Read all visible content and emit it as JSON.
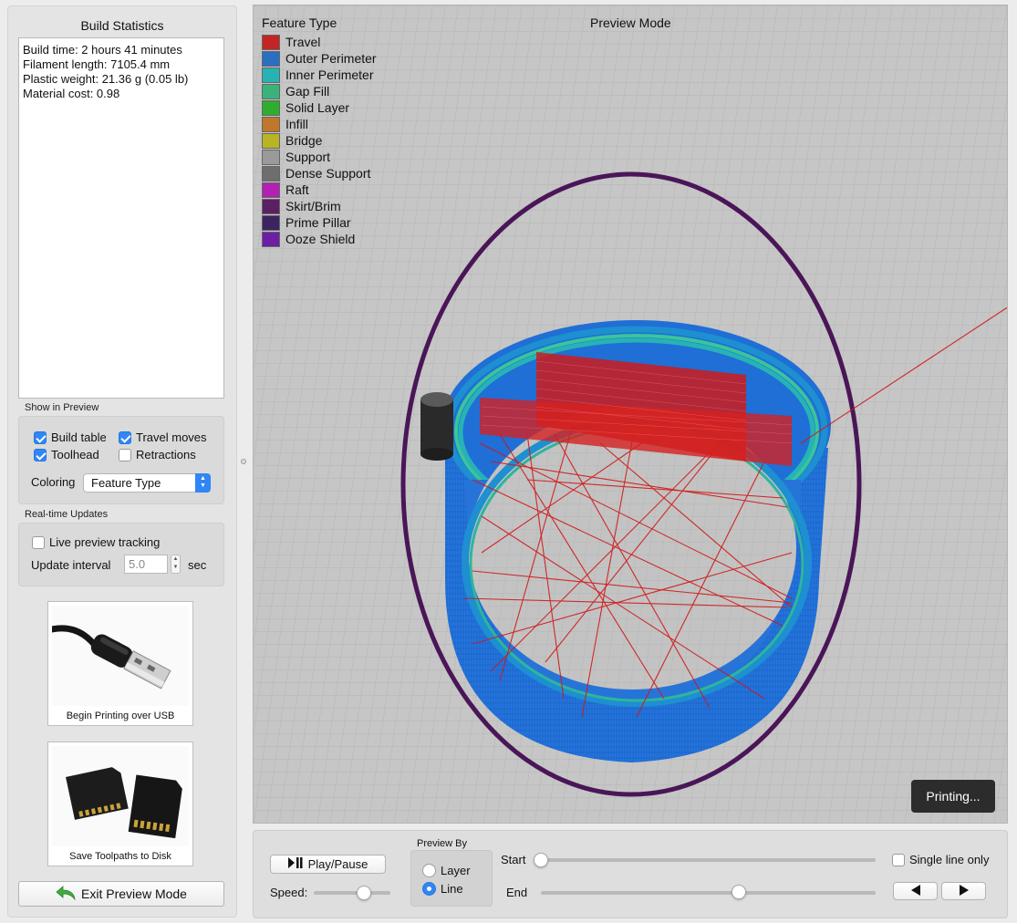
{
  "build_statistics": {
    "title": "Build Statistics",
    "lines": [
      "Build time: 2 hours 41 minutes",
      "Filament length: 7105.4 mm",
      "Plastic weight: 21.36 g (0.05 lb)",
      "Material cost: 0.98"
    ]
  },
  "show_in_preview": {
    "label": "Show in Preview",
    "build_table": {
      "label": "Build table",
      "checked": true
    },
    "travel_moves": {
      "label": "Travel moves",
      "checked": true
    },
    "toolhead": {
      "label": "Toolhead",
      "checked": true
    },
    "retractions": {
      "label": "Retractions",
      "checked": false
    },
    "coloring_label": "Coloring",
    "coloring_value": "Feature Type"
  },
  "realtime_updates": {
    "label": "Real-time Updates",
    "live_tracking": {
      "label": "Live preview tracking",
      "checked": false
    },
    "interval_label": "Update interval",
    "interval_value": "5.0",
    "interval_unit": "sec"
  },
  "actions": {
    "usb_label": "Begin Printing over USB",
    "disk_label": "Save Toolpaths to Disk",
    "exit_label": "Exit Preview Mode"
  },
  "viewport": {
    "legend_title": "Feature Type",
    "mode_title": "Preview Mode",
    "legend": [
      {
        "label": "Travel",
        "color": "#c42424"
      },
      {
        "label": "Outer Perimeter",
        "color": "#2a6fc1"
      },
      {
        "label": "Inner Perimeter",
        "color": "#27b3b6"
      },
      {
        "label": "Gap Fill",
        "color": "#3ab37b"
      },
      {
        "label": "Solid Layer",
        "color": "#2ead2e"
      },
      {
        "label": "Infill",
        "color": "#c0772b"
      },
      {
        "label": "Bridge",
        "color": "#b8b524"
      },
      {
        "label": "Support",
        "color": "#9a9a9a"
      },
      {
        "label": "Dense Support",
        "color": "#6e6e6e"
      },
      {
        "label": "Raft",
        "color": "#b321b3"
      },
      {
        "label": "Skirt/Brim",
        "color": "#5c1f63"
      },
      {
        "label": "Prime Pillar",
        "color": "#3b2460"
      },
      {
        "label": "Ooze Shield",
        "color": "#6b1fa6"
      }
    ],
    "status_badge": "Printing..."
  },
  "controls": {
    "play_pause_label": "Play/Pause",
    "speed_label": "Speed:",
    "speed_level": 0.65,
    "preview_by_label": "Preview By",
    "layer_label": "Layer",
    "line_label": "Line",
    "preview_by_selected": "Line",
    "start_label": "Start",
    "end_label": "End",
    "start_position": 0.0,
    "end_position": 0.59,
    "single_line_label": "Single line only",
    "single_line_checked": false,
    "prev_icon": "triangle-left-icon",
    "next_icon": "triangle-right-icon"
  }
}
